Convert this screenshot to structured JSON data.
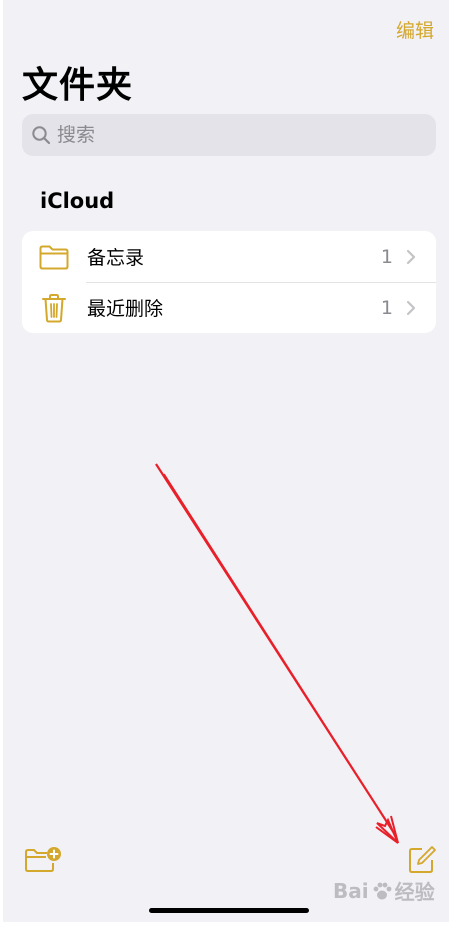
{
  "header": {
    "edit_label": "编辑",
    "title": "文件夹"
  },
  "search": {
    "placeholder": "搜索"
  },
  "sections": [
    {
      "title": "iCloud",
      "folders": [
        {
          "label": "备忘录",
          "count": "1",
          "icon": "folder-icon"
        },
        {
          "label": "最近删除",
          "count": "1",
          "icon": "trash-icon"
        }
      ]
    }
  ],
  "toolbar": {
    "new_folder_icon": "folder-plus-icon",
    "compose_icon": "compose-icon"
  },
  "colors": {
    "accent": "#d4a82c",
    "background": "#f2f1f6",
    "annotation": "#e8202a"
  }
}
